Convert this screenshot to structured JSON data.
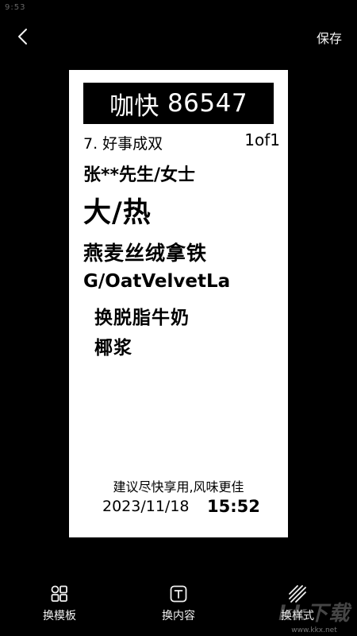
{
  "status_bar": {
    "time": "9:53"
  },
  "header": {
    "back_icon": "chevron-left-icon",
    "save_label": "保存"
  },
  "ticket": {
    "brand": "咖快",
    "order_number": "86547",
    "order_line": "7. 好事成双",
    "count": "1of1",
    "customer": "张**先生/女士",
    "size_temp": "大/热",
    "product_cn": "燕麦丝绒拿铁",
    "product_en": "G/OatVelvetLa",
    "modifiers": [
      "换脱脂牛奶",
      "椰浆"
    ],
    "tip": "建议尽快享用,风味更佳",
    "date": "2023/11/18",
    "time": "15:52"
  },
  "toolbar": {
    "items": [
      {
        "label": "换模板",
        "icon": "grid-template-icon"
      },
      {
        "label": "换内容",
        "icon": "text-box-icon"
      },
      {
        "label": "换样式",
        "icon": "stripes-style-icon"
      }
    ]
  },
  "watermark": {
    "logo_text": "kk下载",
    "url": "www.kkx.net"
  }
}
